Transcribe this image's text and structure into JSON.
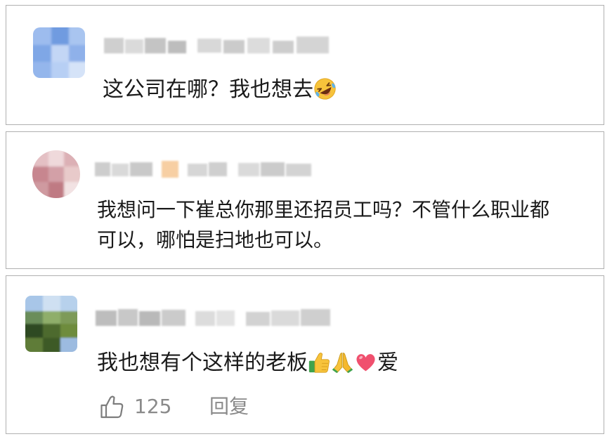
{
  "colors": {
    "text": "#1a1a1a",
    "secondary_text": "#8a8a8a",
    "card_border": "#b0b0b0",
    "heart": "#f0506e",
    "emoji_yellow": "#f7c33b"
  },
  "comments": [
    {
      "text": "这公司在哪？我也想去",
      "emojis": [
        "rolling-on-floor-laughing-emoji"
      ]
    },
    {
      "text": "我想问一下崔总你那里还招员工吗？不管什么职业都可以，哪怕是扫地也可以。"
    },
    {
      "text": "我也想有个这样的老板",
      "emojis": [
        "thumbs-up-emoji",
        "folded-hands-emoji",
        "red-heart-emoji"
      ],
      "text_suffix": "爱",
      "actions": {
        "like_icon": "thumbs-up-outline-icon",
        "like_count": "125",
        "reply_label": "回复"
      }
    }
  ]
}
